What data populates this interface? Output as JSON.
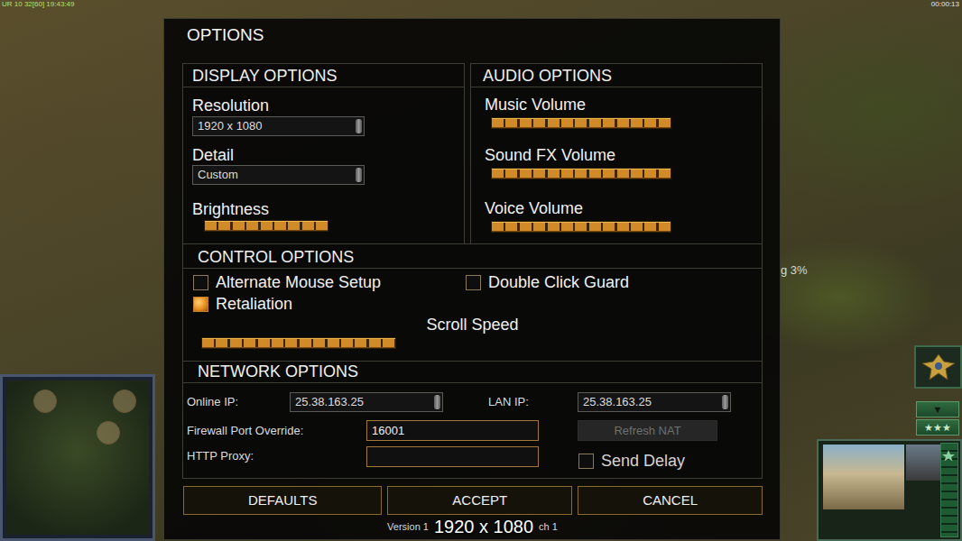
{
  "hud": {
    "stats": "UR 10 32[60] 19:43:49",
    "timer": "00:00:13",
    "progress": "g 3%",
    "scroll_arrow": "▼",
    "rank_button": "★★★"
  },
  "dialog": {
    "title": "OPTIONS",
    "display": {
      "header": "DISPLAY OPTIONS",
      "resolution": {
        "label": "Resolution",
        "value": "1920 x 1080"
      },
      "detail": {
        "label": "Detail",
        "value": "Custom"
      },
      "brightness": {
        "label": "Brightness",
        "level": 1
      }
    },
    "audio": {
      "header": "AUDIO OPTIONS",
      "sliders": [
        {
          "label": "Music Volume",
          "level": 1
        },
        {
          "label": "Sound FX Volume",
          "level": 1
        },
        {
          "label": "Voice Volume",
          "level": 1
        }
      ]
    },
    "control": {
      "header": "CONTROL OPTIONS",
      "checkboxes": [
        {
          "label": "Alternate Mouse Setup",
          "checked": false
        },
        {
          "label": "Double Click Guard",
          "checked": false
        },
        {
          "label": "Retaliation",
          "checked": true
        }
      ],
      "scroll_speed": {
        "label": "Scroll Speed",
        "level": 1
      }
    },
    "network": {
      "header": "NETWORK OPTIONS",
      "online_ip": {
        "label": "Online IP:",
        "value": "25.38.163.25"
      },
      "lan_ip": {
        "label": "LAN IP:",
        "value": "25.38.163.25"
      },
      "firewall": {
        "label": "Firewall Port Override:",
        "value": "16001"
      },
      "proxy": {
        "label": "HTTP Proxy:",
        "value": ""
      },
      "refresh_nat": {
        "label": "Refresh NAT",
        "disabled": true
      },
      "send_delay": {
        "label": "Send Delay",
        "checked": false
      }
    },
    "buttons": [
      "DEFAULTS",
      "ACCEPT",
      "CANCEL"
    ],
    "version_left": "Version 1",
    "version_right": "ch 1"
  },
  "overlay": "1920 x 1080"
}
